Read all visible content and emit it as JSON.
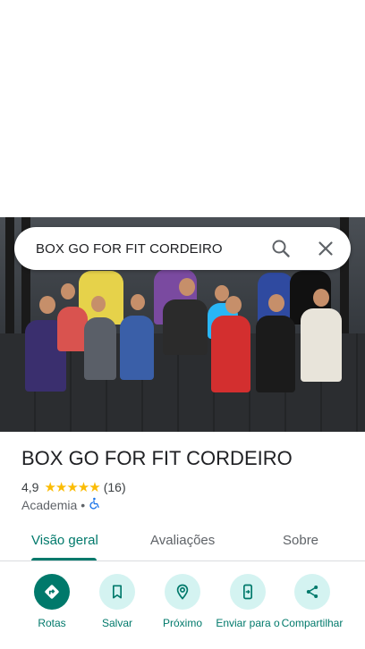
{
  "search": {
    "query": "BOX GO FOR FIT CORDEIRO"
  },
  "place": {
    "title": "BOX GO FOR FIT CORDEIRO",
    "rating": "4,9",
    "stars": "★★★★★",
    "review_count": "(16)",
    "category": "Academia",
    "separator": "•"
  },
  "tabs": [
    {
      "label": "Visão geral",
      "active": true
    },
    {
      "label": "Avaliações",
      "active": false
    },
    {
      "label": "Sobre",
      "active": false
    }
  ],
  "actions": [
    {
      "label": "Rotas",
      "icon": "directions-icon"
    },
    {
      "label": "Salvar",
      "icon": "bookmark-icon"
    },
    {
      "label": "Próximo",
      "icon": "nearby-icon"
    },
    {
      "label": "Enviar para o",
      "icon": "send-to-phone-icon"
    },
    {
      "label": "Compartilhar",
      "icon": "share-icon"
    }
  ],
  "colors": {
    "accent": "#00796b",
    "accent_light": "#d4f3f1",
    "stars": "#fbbc04",
    "wheelchair": "#1a73e8"
  }
}
